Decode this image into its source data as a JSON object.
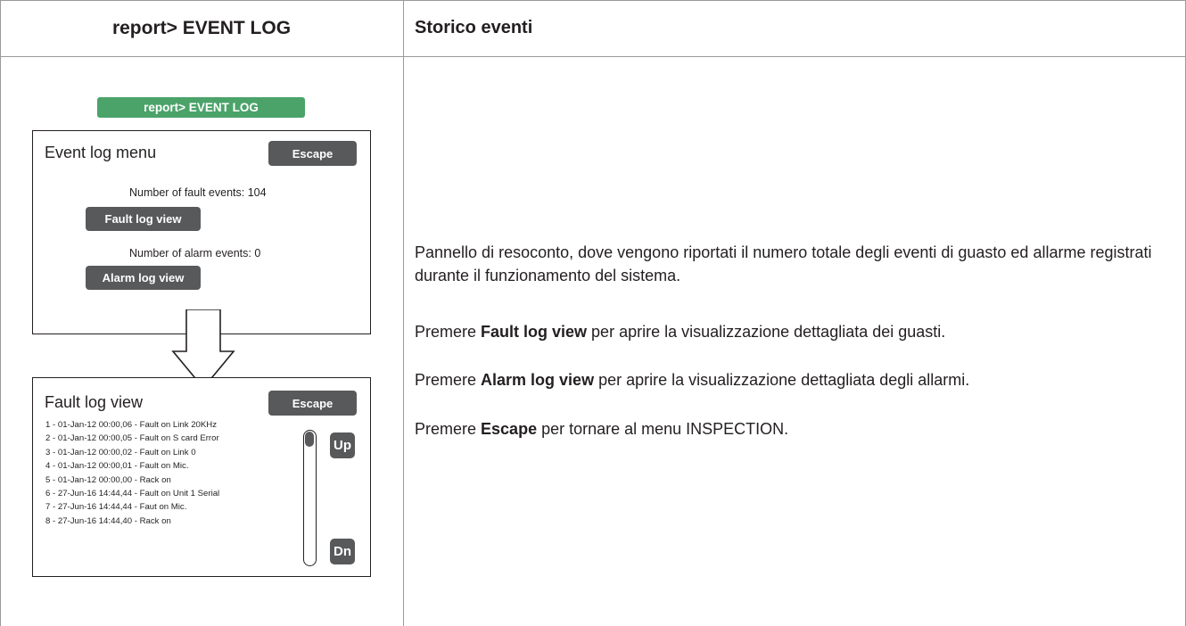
{
  "header": {
    "left_title": "report> EVENT LOG",
    "right_title": "Storico eventi"
  },
  "screen": {
    "report_badge": "report> EVENT LOG",
    "badge_color": "#4ba36a",
    "event_log_menu": {
      "title": "Event log menu",
      "escape_label": "Escape",
      "fault_count_label": "Number of fault events:",
      "fault_count": "104",
      "fault_button": "Fault log view",
      "alarm_count_label": "Number of alarm events:",
      "alarm_count": "0",
      "alarm_button": "Alarm log view"
    },
    "arrow_icon": "down-arrow-icon",
    "fault_log_view": {
      "title": "Fault log view",
      "escape_label": "Escape",
      "entries": [
        "1 - 01-Jan-12  00:00,06 - Fault on Link 20KHz",
        "2 - 01-Jan-12  00:00,05 - Fault on S card Error",
        "3 - 01-Jan-12  00:00,02 - Fault on Link 0",
        "4 - 01-Jan-12  00:00,01 - Fault on Mic.",
        "5 - 01-Jan-12  00:00,00 - Rack on",
        "6 - 27-Jun-16  14:44,44 - Fault on Unit 1 Serial",
        "7 - 27-Jun-16  14:44,44 - Faut on Mic.",
        "8 - 27-Jun-16  14:44,40 - Rack on"
      ],
      "up_label": "Up",
      "down_label": "Dn"
    }
  },
  "description": {
    "intro": "Pannello di resoconto, dove vengono riportati il numero totale degli eventi di guasto ed allarme registrati durante il funzionamento del sistema.",
    "fault": {
      "before": "Premere ",
      "bold": "Fault log view",
      "after": " per aprire la visualizzazione dettagliata dei guasti."
    },
    "alarm": {
      "before": "Premere ",
      "bold": "Alarm log view",
      "after": " per aprire la visualizzazione dettagliata degli allarmi."
    },
    "escape": {
      "before": "Premere ",
      "bold": "Escape",
      "after": " per tornare al menu INSPECTION."
    }
  }
}
